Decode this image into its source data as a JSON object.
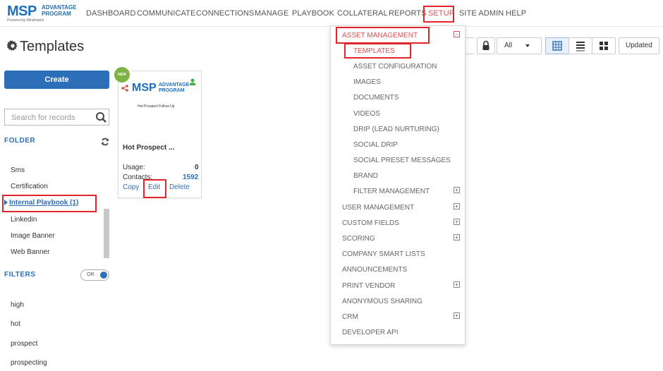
{
  "logo": {
    "brand": "MSP",
    "line1": "ADVANTAGE",
    "line2": "PROGRAM",
    "powered": "Powered by Mindmatrix"
  },
  "nav": [
    "DASHBOARD",
    "COMMUNICATE",
    "CONNECTIONS",
    "MANAGE",
    "PLAYBOOK",
    "COLLATERAL",
    "REPORTS",
    "SETUP",
    "SITE ADMIN",
    "HELP"
  ],
  "page": {
    "title": "Templates"
  },
  "sidebar": {
    "create_label": "Create",
    "search_placeholder": "Search for records",
    "folder_label": "FOLDER",
    "folders": [
      "Sms",
      "Certification",
      "Internal Playbook  (1)",
      "Linkedin",
      "Image Banner",
      "Web Banner"
    ],
    "filters_label": "FILTERS",
    "toggle_label": "OR",
    "filters": [
      "high",
      "hot",
      "prospect",
      "prospecting"
    ]
  },
  "card": {
    "badge": "NEW",
    "thumb_brand": "MSP",
    "thumb_line1": "ADVANTAGE",
    "thumb_line2": "PROGRAM",
    "thumb_subtitle": "Hot Prospect Follow Up",
    "title": "Hot Prospect ...",
    "usage_label": "Usage:",
    "usage_value": "0",
    "contacts_label": "Contacts:",
    "contacts_value": "1592",
    "actions": [
      "Copy",
      "Edit",
      "Delete"
    ]
  },
  "toolbar": {
    "filter_value": "All",
    "sort_label": "Updated"
  },
  "setup_menu": {
    "asset_management": "ASSET MANAGEMENT",
    "asset_items": [
      "TEMPLATES",
      "ASSET CONFIGURATION",
      "IMAGES",
      "DOCUMENTS",
      "VIDEOS",
      "DRIP (LEAD NURTURING)",
      "SOCIAL DRIP",
      "SOCIAL PRESET MESSAGES",
      "BRAND",
      "FILTER MANAGEMENT"
    ],
    "groups": [
      "USER MANAGEMENT",
      "CUSTOM FIELDS",
      "SCORING",
      "COMPANY SMART LISTS",
      "ANNOUNCEMENTS",
      "PRINT VENDOR",
      "ANONYMOUS SHARING",
      "CRM",
      "DEVELOPER API"
    ]
  },
  "colors": {
    "accent_blue": "#2d6eb8",
    "highlight_red": "#e0262b",
    "active_nav": "#d9534f"
  }
}
